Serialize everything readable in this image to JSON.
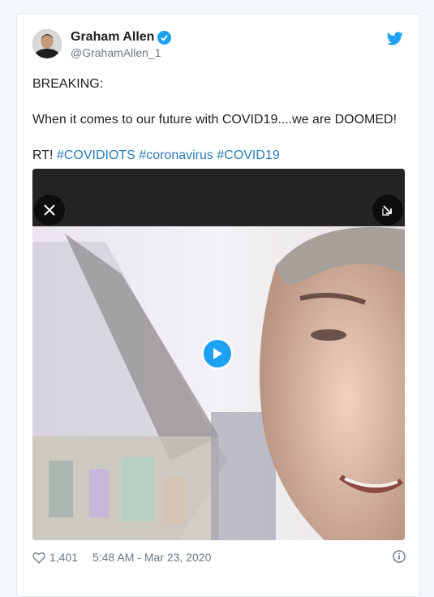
{
  "tweet": {
    "author_name": "Graham Allen",
    "author_handle": "@GrahamAllen_1",
    "verified": true,
    "text_lines": [
      "BREAKING:",
      "When it comes to our future with COVID19....we are DOOMED!"
    ],
    "rt_prefix": "RT!",
    "hashtags": [
      "#COVIDIOTS",
      "#coronavirus",
      "#COVID19"
    ],
    "likes": "1,401",
    "timestamp": "5:48 AM - Mar 23, 2020"
  },
  "icons": {
    "logo": "twitter-bird-icon",
    "verified": "verified-badge-icon",
    "close": "close-icon",
    "expand": "expand-icon",
    "play": "play-icon",
    "like": "heart-icon",
    "info": "info-icon"
  },
  "colors": {
    "brand": "#1da1f2",
    "hashtag": "#2b7bb9",
    "muted": "#697882",
    "card_border": "#e1e8ed"
  }
}
